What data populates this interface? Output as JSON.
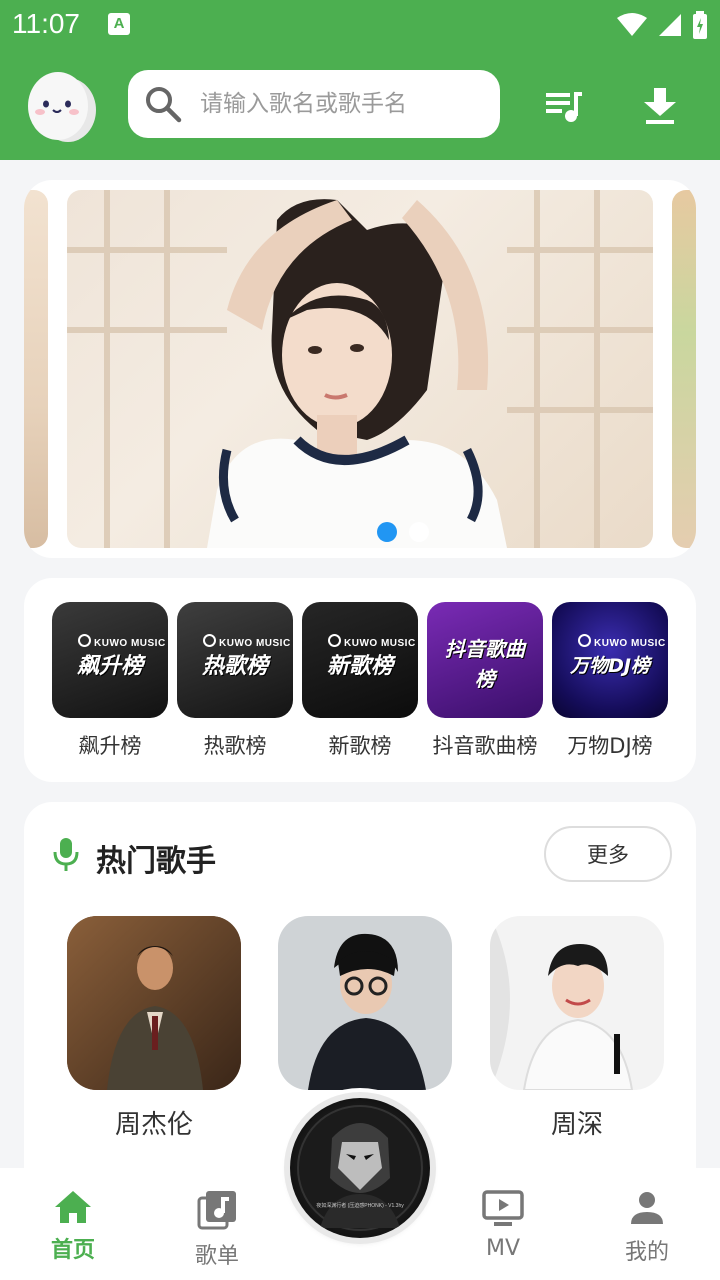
{
  "status_bar": {
    "time": "11:07",
    "notif_badge": "A"
  },
  "header": {
    "search_placeholder": "请输入歌名或歌手名"
  },
  "banner": {
    "slides": 2,
    "active_index": 0
  },
  "charts": [
    {
      "label": "飙升榜",
      "cover_text": "飙升榜",
      "cover_color": "#1c1c1c"
    },
    {
      "label": "热歌榜",
      "cover_text": "热歌榜",
      "cover_color": "#222222"
    },
    {
      "label": "新歌榜",
      "cover_text": "新歌榜",
      "cover_color": "#1e1e1e"
    },
    {
      "label": "抖音歌曲榜",
      "cover_text": "抖音歌曲榜",
      "cover_color": "#5a1d8f"
    },
    {
      "label": "万物DJ榜",
      "cover_text": "万物DJ榜",
      "cover_color": "#1b1470"
    }
  ],
  "cover_brand": "KUWO MUSIC",
  "hot_singers": {
    "title": "热门歌手",
    "more_label": "更多",
    "singers": [
      {
        "name": "周杰伦"
      },
      {
        "name": "…"
      },
      {
        "name": "周深"
      }
    ]
  },
  "bottom_nav": {
    "items": [
      {
        "label": "首页",
        "icon": "home-icon",
        "active": true
      },
      {
        "label": "歌单",
        "icon": "music-album-icon",
        "active": false
      },
      {
        "label": "MV",
        "icon": "video-icon",
        "active": false
      },
      {
        "label": "我的",
        "icon": "person-icon",
        "active": false
      }
    ],
    "now_playing_text": "夜如深渊行者 (压迫感PHONK) - V1.3hy"
  },
  "colors": {
    "accent": "#4caf50",
    "dot_active": "#2196f3"
  }
}
